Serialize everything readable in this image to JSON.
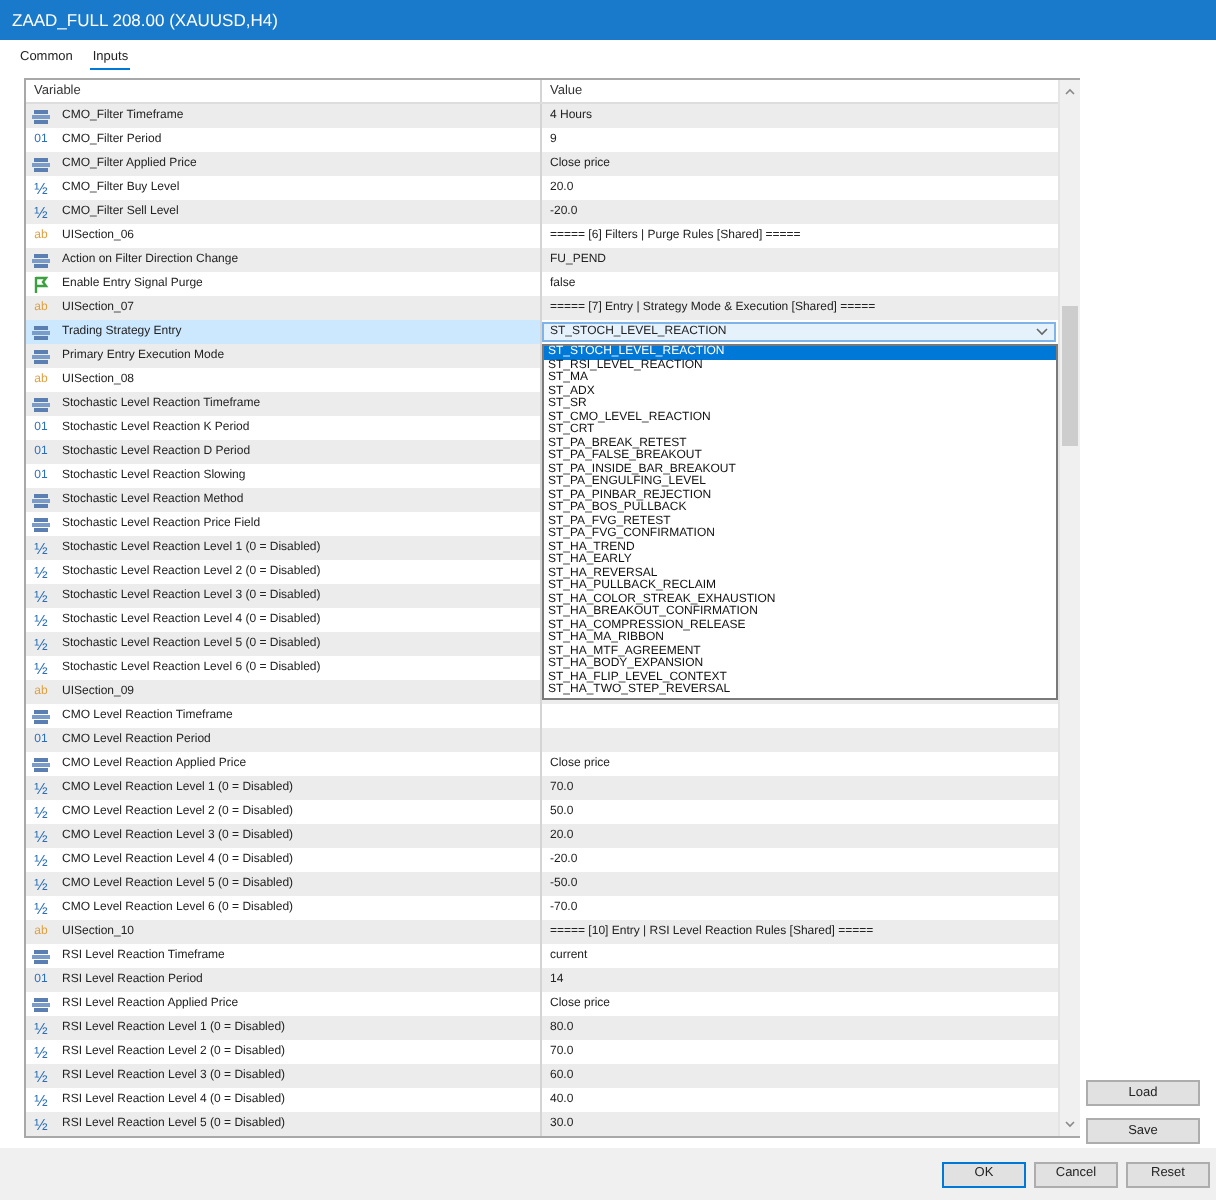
{
  "window": {
    "title": "ZAAD_FULL 208.00 (XAUUSD,H4)"
  },
  "tabs": [
    {
      "label": "Common",
      "selected": false
    },
    {
      "label": "Inputs",
      "selected": true
    }
  ],
  "table": {
    "columns": [
      "Variable",
      "Value"
    ],
    "rows": [
      {
        "kind": "enum",
        "variable": "CMO_Filter Timeframe",
        "value": "4 Hours",
        "selected": false
      },
      {
        "kind": "int",
        "icon_text": "01",
        "variable": "CMO_Filter Period",
        "value": "9",
        "selected": false
      },
      {
        "kind": "enum",
        "variable": "CMO_Filter Applied Price",
        "value": "Close price",
        "selected": false
      },
      {
        "kind": "double",
        "icon_text": "½",
        "variable": "CMO_Filter Buy Level",
        "value": "20.0",
        "selected": false
      },
      {
        "kind": "double",
        "icon_text": "½",
        "variable": "CMO_Filter Sell Level",
        "value": "-20.0",
        "selected": false
      },
      {
        "kind": "string",
        "icon_text": "ab",
        "variable": "UISection_06",
        "value": "===== [6] Filters | Purge Rules [Shared] =====",
        "selected": false
      },
      {
        "kind": "enum",
        "variable": "Action on Filter Direction Change",
        "value": "FU_PEND",
        "selected": false
      },
      {
        "kind": "bool",
        "variable": "Enable Entry Signal Purge",
        "value": "false",
        "selected": false
      },
      {
        "kind": "string",
        "icon_text": "ab",
        "variable": "UISection_07",
        "value": "===== [7] Entry | Strategy Mode & Execution [Shared] =====",
        "selected": false
      },
      {
        "kind": "enum",
        "variable": "Trading Strategy Entry",
        "value": "ST_STOCH_LEVEL_REACTION",
        "selected": true
      },
      {
        "kind": "enum",
        "variable": "Primary Entry Execution Mode",
        "selected": false
      },
      {
        "kind": "string",
        "icon_text": "ab",
        "variable": "UISection_08",
        "selected": false
      },
      {
        "kind": "enum",
        "variable": "Stochastic Level Reaction Timeframe",
        "selected": false
      },
      {
        "kind": "int",
        "icon_text": "01",
        "variable": "Stochastic Level Reaction K Period",
        "selected": false
      },
      {
        "kind": "int",
        "icon_text": "01",
        "variable": "Stochastic Level Reaction D Period",
        "selected": false
      },
      {
        "kind": "int",
        "icon_text": "01",
        "variable": "Stochastic Level Reaction Slowing",
        "selected": false
      },
      {
        "kind": "enum",
        "variable": "Stochastic Level Reaction Method",
        "selected": false
      },
      {
        "kind": "enum",
        "variable": "Stochastic Level Reaction Price Field",
        "selected": false
      },
      {
        "kind": "double",
        "icon_text": "½",
        "variable": "Stochastic Level Reaction Level 1 (0 = Disabled)",
        "selected": false
      },
      {
        "kind": "double",
        "icon_text": "½",
        "variable": "Stochastic Level Reaction Level 2 (0 = Disabled)",
        "selected": false
      },
      {
        "kind": "double",
        "icon_text": "½",
        "variable": "Stochastic Level Reaction Level 3 (0 = Disabled)",
        "selected": false
      },
      {
        "kind": "double",
        "icon_text": "½",
        "variable": "Stochastic Level Reaction Level 4 (0 = Disabled)",
        "selected": false
      },
      {
        "kind": "double",
        "icon_text": "½",
        "variable": "Stochastic Level Reaction Level 5 (0 = Disabled)",
        "selected": false
      },
      {
        "kind": "double",
        "icon_text": "½",
        "variable": "Stochastic Level Reaction Level 6 (0 = Disabled)",
        "selected": false
      },
      {
        "kind": "string",
        "icon_text": "ab",
        "variable": "UISection_09",
        "selected": false
      },
      {
        "kind": "enum",
        "variable": "CMO Level Reaction Timeframe",
        "selected": false
      },
      {
        "kind": "int",
        "icon_text": "01",
        "variable": "CMO Level Reaction Period",
        "selected": false
      },
      {
        "kind": "enum",
        "variable": "CMO Level Reaction Applied Price",
        "value": "Close price",
        "selected": false
      },
      {
        "kind": "double",
        "icon_text": "½",
        "variable": "CMO Level Reaction Level 1 (0 = Disabled)",
        "value": "70.0",
        "selected": false
      },
      {
        "kind": "double",
        "icon_text": "½",
        "variable": "CMO Level Reaction Level 2 (0 = Disabled)",
        "value": "50.0",
        "selected": false
      },
      {
        "kind": "double",
        "icon_text": "½",
        "variable": "CMO Level Reaction Level 3 (0 = Disabled)",
        "value": "20.0",
        "selected": false
      },
      {
        "kind": "double",
        "icon_text": "½",
        "variable": "CMO Level Reaction Level 4 (0 = Disabled)",
        "value": "-20.0",
        "selected": false
      },
      {
        "kind": "double",
        "icon_text": "½",
        "variable": "CMO Level Reaction Level 5 (0 = Disabled)",
        "value": "-50.0",
        "selected": false
      },
      {
        "kind": "double",
        "icon_text": "½",
        "variable": "CMO Level Reaction Level 6 (0 = Disabled)",
        "value": "-70.0",
        "selected": false
      },
      {
        "kind": "string",
        "icon_text": "ab",
        "variable": "UISection_10",
        "value": "===== [10] Entry | RSI Level Reaction Rules [Shared] =====",
        "selected": false
      },
      {
        "kind": "enum",
        "variable": "RSI Level Reaction Timeframe",
        "value": "current",
        "selected": false
      },
      {
        "kind": "int",
        "icon_text": "01",
        "variable": "RSI Level Reaction Period",
        "value": "14",
        "selected": false
      },
      {
        "kind": "enum",
        "variable": "RSI Level Reaction Applied Price",
        "value": "Close price",
        "selected": false
      },
      {
        "kind": "double",
        "icon_text": "½",
        "variable": "RSI Level Reaction Level 1 (0 = Disabled)",
        "value": "80.0",
        "selected": false
      },
      {
        "kind": "double",
        "icon_text": "½",
        "variable": "RSI Level Reaction Level 2 (0 = Disabled)",
        "value": "70.0",
        "selected": false
      },
      {
        "kind": "double",
        "icon_text": "½",
        "variable": "RSI Level Reaction Level 3 (0 = Disabled)",
        "value": "60.0",
        "selected": false
      },
      {
        "kind": "double",
        "icon_text": "½",
        "variable": "RSI Level Reaction Level 4 (0 = Disabled)",
        "value": "40.0",
        "selected": false
      },
      {
        "kind": "double",
        "icon_text": "½",
        "variable": "RSI Level Reaction Level 5 (0 = Disabled)",
        "value": "30.0",
        "selected": false
      }
    ]
  },
  "dropdown": {
    "items": [
      {
        "label": "ST_STOCH_LEVEL_REACTION",
        "selected": true
      },
      {
        "label": "ST_RSI_LEVEL_REACTION",
        "selected": false
      },
      {
        "label": "ST_MA",
        "selected": false
      },
      {
        "label": "ST_ADX",
        "selected": false
      },
      {
        "label": "ST_SR",
        "selected": false
      },
      {
        "label": "ST_CMO_LEVEL_REACTION",
        "selected": false
      },
      {
        "label": "ST_CRT",
        "selected": false
      },
      {
        "label": "ST_PA_BREAK_RETEST",
        "selected": false
      },
      {
        "label": "ST_PA_FALSE_BREAKOUT",
        "selected": false
      },
      {
        "label": "ST_PA_INSIDE_BAR_BREAKOUT",
        "selected": false
      },
      {
        "label": "ST_PA_ENGULFING_LEVEL",
        "selected": false
      },
      {
        "label": "ST_PA_PINBAR_REJECTION",
        "selected": false
      },
      {
        "label": "ST_PA_BOS_PULLBACK",
        "selected": false
      },
      {
        "label": "ST_PA_FVG_RETEST",
        "selected": false
      },
      {
        "label": "ST_PA_FVG_CONFIRMATION",
        "selected": false
      },
      {
        "label": "ST_HA_TREND",
        "selected": false
      },
      {
        "label": "ST_HA_EARLY",
        "selected": false
      },
      {
        "label": "ST_HA_REVERSAL",
        "selected": false
      },
      {
        "label": "ST_HA_PULLBACK_RECLAIM",
        "selected": false
      },
      {
        "label": "ST_HA_COLOR_STREAK_EXHAUSTION",
        "selected": false
      },
      {
        "label": "ST_HA_BREAKOUT_CONFIRMATION",
        "selected": false
      },
      {
        "label": "ST_HA_COMPRESSION_RELEASE",
        "selected": false
      },
      {
        "label": "ST_HA_MA_RIBBON",
        "selected": false
      },
      {
        "label": "ST_HA_MTF_AGREEMENT",
        "selected": false
      },
      {
        "label": "ST_HA_BODY_EXPANSION",
        "selected": false
      },
      {
        "label": "ST_HA_FLIP_LEVEL_CONTEXT",
        "selected": false
      },
      {
        "label": "ST_HA_TWO_STEP_REVERSAL",
        "selected": false
      }
    ]
  },
  "side_buttons": [
    "Load",
    "Save"
  ],
  "buttons": [
    "OK",
    "Cancel",
    "Reset"
  ]
}
